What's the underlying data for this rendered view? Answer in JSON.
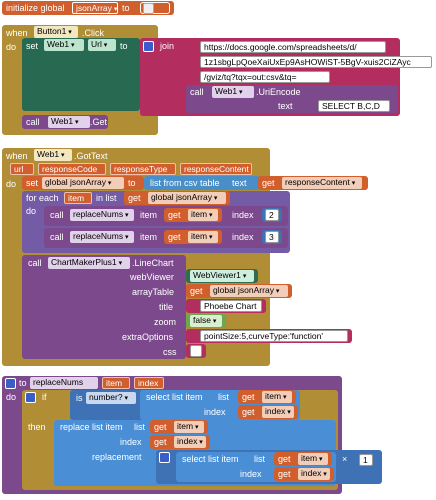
{
  "global_init": {
    "label": "initialize global",
    "name": "jsonArray",
    "to": "to"
  },
  "event1": {
    "when": "when",
    "component": "Button1",
    "event": ".Click",
    "do": "do",
    "set": "set",
    "target": "Web1",
    "property": "Url",
    "to": "to",
    "join": "join",
    "strings": [
      "https://docs.google.com/spreadsheets/d/",
      "1z1sbgLpQoeXaiUxEp9AsHOWiST-5BgV-xuis2CiZAyc",
      "/gviz/tq?tqx=out:csv&tq="
    ],
    "call": "call",
    "uriencode_component": "Web1",
    "uriencode_method": ".UriEncode",
    "text_label": "text",
    "query": "SELECT B,C,D",
    "get_component": "Web1",
    "get_method": ".Get"
  },
  "event2": {
    "when": "when",
    "component": "Web1",
    "event": ".GotText",
    "params": [
      "url",
      "responseCode",
      "responseType",
      "responseContent"
    ],
    "do": "do",
    "set": "set",
    "set_var": "global jsonArray",
    "to": "to",
    "list_from_csv": "list from csv table",
    "text_label": "text",
    "get": "get",
    "response_content": "responseContent",
    "for_each": "for each",
    "item": "item",
    "in_list": "in list",
    "global_json": "global jsonArray",
    "call": "call",
    "replace_proc": "replaceNums",
    "item_label": "item",
    "index_label": "index",
    "index_values": [
      "2",
      "3"
    ],
    "chart_component": "ChartMakerPlus1",
    "chart_method": ".LineChart",
    "args": {
      "webViewer": "webViewer",
      "arrayTable": "arrayTable",
      "title": "title",
      "zoom": "zoom",
      "extraOptions": "extraOptions",
      "css": "css"
    },
    "webviewer_value": "WebViewer1",
    "title_value": "Phoebe Chart",
    "zoom_value": "false",
    "extra_value": "pointSize:5,curveType:'function'"
  },
  "procedure": {
    "to": "to",
    "name": "replaceNums",
    "params": [
      "item",
      "index"
    ],
    "do": "do",
    "if": "if",
    "then": "then",
    "is_number": "is",
    "number_dd": "number?",
    "select_list_item": "select list item",
    "list": "list",
    "index": "index",
    "get": "get",
    "item": "item",
    "replace_list_item": "replace list item",
    "replacement": "replacement",
    "times": "×",
    "one": "1"
  }
}
